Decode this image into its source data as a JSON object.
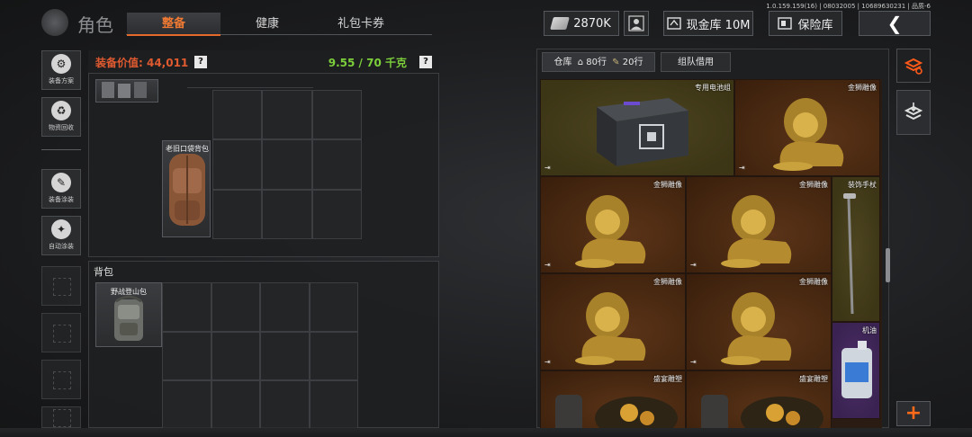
{
  "version_text": "1.0.159.159(16) | 08032005 | 10689630231 | 品质-6",
  "header": {
    "title": "角色",
    "tabs": [
      {
        "label": "整备",
        "active": true
      },
      {
        "label": "健康",
        "active": false
      },
      {
        "label": "礼包卡券",
        "active": false
      }
    ],
    "currency": "2870K",
    "cash_storage_label": "现金库 10M",
    "safe_label": "保险库",
    "back_label": "❮"
  },
  "sidebar": {
    "items": [
      {
        "label": "装备方案",
        "icon": "gear-plan-icon"
      },
      {
        "label": "物资回收",
        "icon": "recycle-icon"
      },
      {
        "label": "装备涂装",
        "icon": "paint-icon"
      },
      {
        "label": "自动涂装",
        "icon": "auto-paint-icon"
      }
    ]
  },
  "equipment": {
    "value_label": "装备价值: 44,011",
    "weight": "9.55 / 70 千克",
    "help": "?",
    "chest_item": "老旧口袋背包",
    "backpack_section_label": "背包",
    "backpack_item": "野战登山包"
  },
  "warehouse": {
    "tab_storage": "仓库",
    "rows_label_1": "80行",
    "rows_label_2": "20行",
    "tab_team": "组队借用",
    "items": [
      {
        "name": "专用电池组",
        "color": "olive"
      },
      {
        "name": "金狮雕像",
        "color": "brown"
      },
      {
        "name": "金狮雕像",
        "color": "brown"
      },
      {
        "name": "金狮雕像",
        "color": "brown"
      },
      {
        "name": "装饰手杖",
        "color": "olive"
      },
      {
        "name": "金狮雕像",
        "color": "brown"
      },
      {
        "name": "金狮雕像",
        "color": "brown"
      },
      {
        "name": "机油",
        "color": "purple"
      },
      {
        "name": "盛宴雕塑",
        "color": "brown"
      },
      {
        "name": "盛宴雕塑",
        "color": "brown"
      }
    ],
    "add_label": "+"
  },
  "colors": {
    "accent": "#f07a33",
    "weight_green": "#7ccf3a",
    "value_red": "#e05a30"
  }
}
